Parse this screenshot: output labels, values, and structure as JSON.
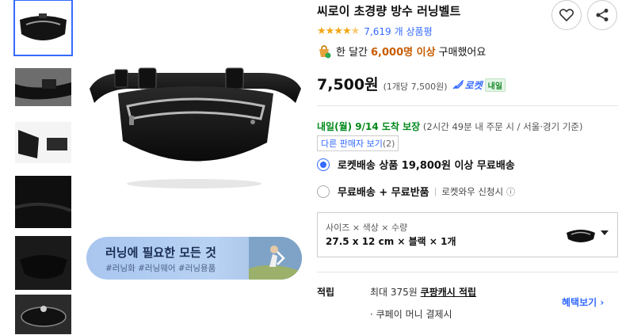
{
  "product": {
    "title": "씨로이 초경량 방수 러닝벨트",
    "rating_stars": [
      "★",
      "★",
      "★",
      "★",
      "★"
    ],
    "review_count": "7,619",
    "review_suffix": "개 상품평",
    "sold_prefix": "한 달간",
    "sold_count": "6,000명 이상",
    "sold_suffix": "구매했어요",
    "price": "7,500원",
    "unit_price": "(1개당 7,500원)",
    "rocket_label": "로켓",
    "rocket_badge": "내일"
  },
  "delivery": {
    "date": "내일(월) 9/14 도착 보장",
    "detail": "(2시간 49분 내 주문 시 / 서울·경기 기준)",
    "other_sellers": "다른 판매자 보기",
    "other_sellers_count": "(2)"
  },
  "shipping_options": [
    {
      "label": "로켓배송 상품 19,800원 이상 무료배송",
      "selected": true
    },
    {
      "label": "무료배송 + 무료반품",
      "extra": "로켓와우 신청시",
      "selected": false
    }
  ],
  "option_selector": {
    "label": "사이즈 × 색상 × 수량",
    "value": "27.5 x 12 cm × 블랙 × 1개"
  },
  "points": {
    "label": "적립",
    "line1_prefix": "최대 375원",
    "line1_link": "쿠팡캐시 적립",
    "line2": "· 쿠페이 머니 결제시",
    "benefit_link": "혜택보기 ›"
  },
  "banner": {
    "title": "러닝에 필요한 모든 것",
    "tags": "#러닝화 #러닝웨어 #러닝용품"
  },
  "icons": [
    "heart-icon",
    "share-icon",
    "star-icon",
    "cart-badge-icon",
    "rocket-icon",
    "info-icon",
    "chevron-right-icon",
    "caret-down-icon"
  ],
  "colors": {
    "accent": "#346aff",
    "rating": "#f3a715",
    "delivery_green": "#00891a",
    "sold_highlight": "#c75c00"
  }
}
